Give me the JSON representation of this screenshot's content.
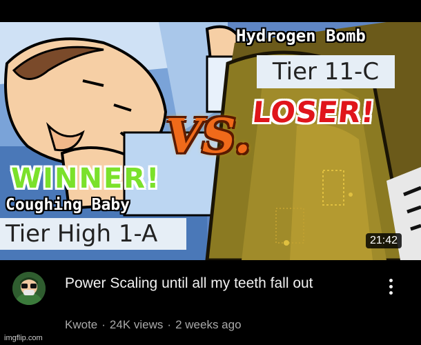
{
  "video": {
    "thumbnail": {
      "top_label": "Hydrogen Bomb",
      "top_tier": "Tier 11-C",
      "loser_label": "LOSER!",
      "vs_label": "VS.",
      "winner_label": "WINNER!",
      "bottom_label": "Coughing Baby",
      "bottom_tier": "Tier High 1-A",
      "duration": "21:42"
    },
    "title": "Power Scaling until all my teeth fall out",
    "channel": "Kwote",
    "views": "24K views",
    "age": "2 weeks ago",
    "separator": "·",
    "more_icon": "vertical-ellipsis-icon"
  },
  "watermark": "imgflip.com",
  "colors": {
    "background": "#000000",
    "winner_green": "#7be12b",
    "loser_red": "#e0151b",
    "vs_orange": "#f06a1a",
    "subtext_gray": "#aaaaaa"
  }
}
